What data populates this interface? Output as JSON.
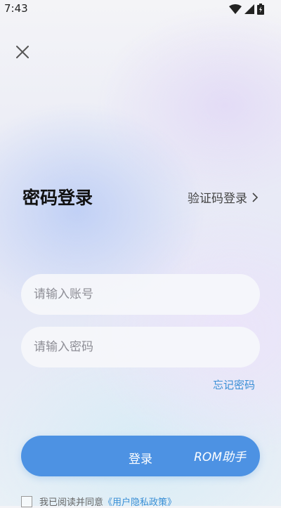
{
  "status_bar": {
    "time": "7:43"
  },
  "page": {
    "title": "密码登录",
    "switch_link_label": "验证码登录"
  },
  "form": {
    "account_placeholder": "请输入账号",
    "password_placeholder": "请输入密码",
    "forgot_password": "忘记密码",
    "login_button": "登录",
    "watermark": "ROM助手"
  },
  "agreement": {
    "prefix": "我已阅读并同意",
    "policy_link": "《用户隐私政策》"
  },
  "colors": {
    "accent": "#4d92e3",
    "link": "#3a8fd6"
  }
}
